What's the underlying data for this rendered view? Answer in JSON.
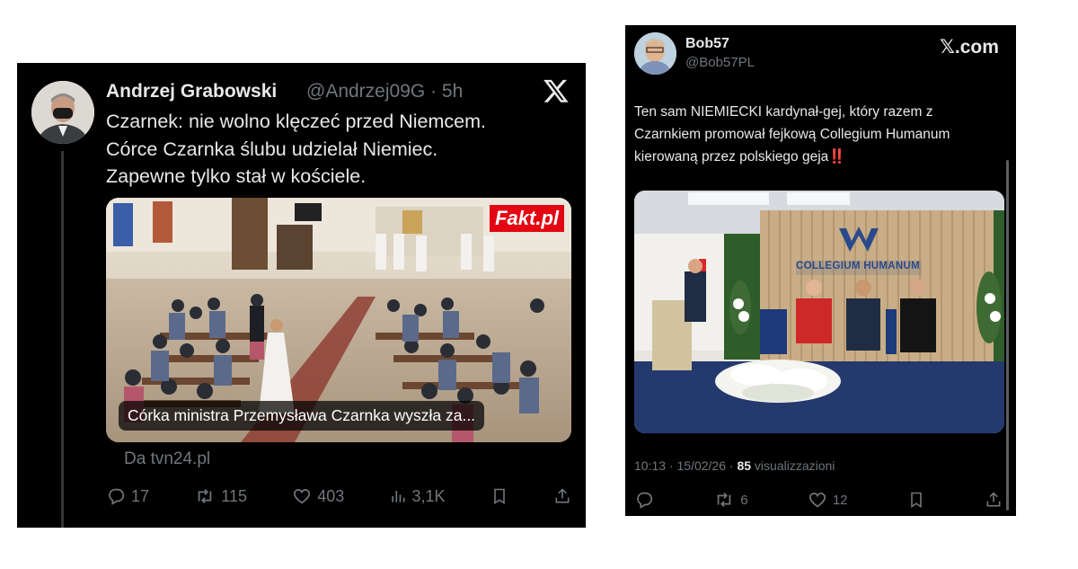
{
  "left_post": {
    "author_name": "Andrzej Grabowski",
    "handle": "@Andrzej09G",
    "separator": "·",
    "time": "5h",
    "x_logo": "X",
    "text_lines": [
      "Czarnek: nie wolno klęczeć przed Niemcem.",
      "Córce Czarnka ślubu udzielał Niemiec.",
      "Zapewne tylko stał w kościele."
    ],
    "media": {
      "badge": "Fakt.pl",
      "caption": "Córka ministra Przemysława Czarnka wyszła za..."
    },
    "source": "Da tvn24.pl",
    "actions": {
      "replies": "17",
      "reposts": "115",
      "likes": "403",
      "views": "3,1K"
    },
    "icons": [
      "reply-icon",
      "repost-icon",
      "like-icon",
      "views-icon",
      "bookmark-icon",
      "share-icon"
    ]
  },
  "right_post": {
    "author_name": "Bob57",
    "handle": "@Bob57PL",
    "brand": "𝕏.com",
    "text": "Ten sam NIEMIECKI kardynał-gej, który razem z Czarnkiem promował fejkową Collegium Humanum kierowaną przez polskiego geja",
    "emoji": "‼️",
    "media": {
      "logo_text": "COLLEGIUM HUMANUM"
    },
    "meta": {
      "time": "10:13",
      "date": "15/02/26",
      "separator": "·",
      "views_count": "85",
      "views_label": "visualizzazioni"
    },
    "actions": {
      "reposts": "6",
      "likes": "12"
    },
    "icons": [
      "reply-icon",
      "repost-icon",
      "like-icon",
      "bookmark-icon",
      "share-icon"
    ]
  }
}
